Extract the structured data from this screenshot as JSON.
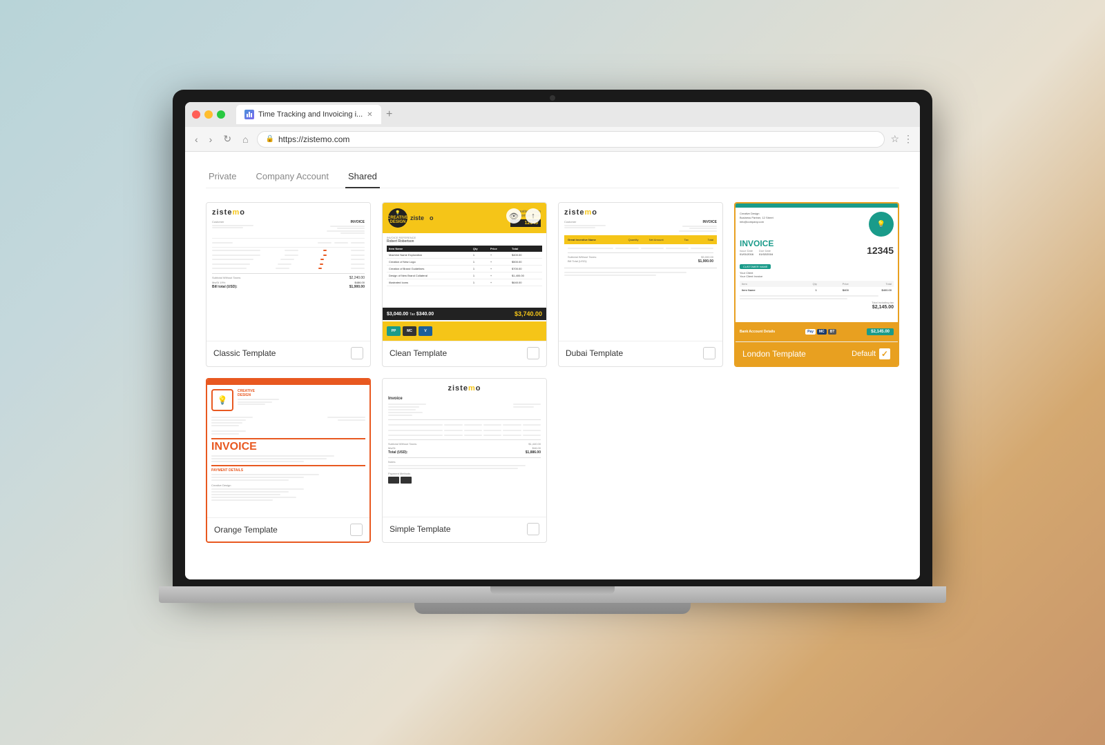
{
  "browser": {
    "url": "https://zistemo.com",
    "tab_title": "Time Tracking and Invoicing i...",
    "tab_favicon": "zistemo"
  },
  "nav": {
    "back": "‹",
    "forward": "›",
    "refresh": "↻",
    "home": "⌂",
    "bookmark": "☆",
    "menu": "⋮"
  },
  "tabs": [
    {
      "label": "Private",
      "active": false
    },
    {
      "label": "Company Account",
      "active": false
    },
    {
      "label": "Shared",
      "active": true
    }
  ],
  "templates": [
    {
      "id": "classic",
      "name": "Classic Template",
      "selected": false,
      "type": "classic"
    },
    {
      "id": "clean",
      "name": "Clean Template",
      "selected": false,
      "type": "clean"
    },
    {
      "id": "dubai",
      "name": "Dubai Template",
      "selected": false,
      "type": "dubai"
    },
    {
      "id": "london",
      "name": "London Template",
      "selected": true,
      "default_label": "Default",
      "type": "london"
    }
  ],
  "templates_row2": [
    {
      "id": "orange",
      "name": "Orange Template",
      "selected": false,
      "type": "orange"
    },
    {
      "id": "simple",
      "name": "Simple Template",
      "selected": false,
      "type": "simple"
    }
  ],
  "zistemo_logo": "zistemo",
  "invoice_number": "12345",
  "total_amount": "$3,740.00",
  "default_check": "✓"
}
